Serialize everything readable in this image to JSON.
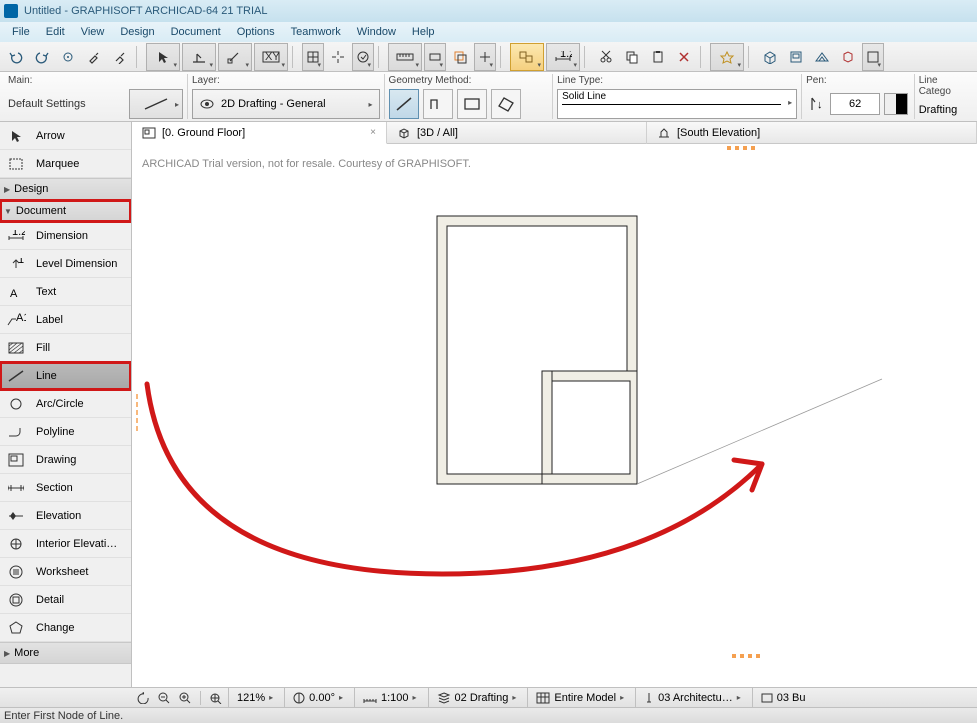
{
  "title": "Untitled - GRAPHISOFT ARCHICAD-64 21 TRIAL",
  "menubar": [
    "File",
    "Edit",
    "View",
    "Design",
    "Document",
    "Options",
    "Teamwork",
    "Window",
    "Help"
  ],
  "toolbar2": {
    "main_label": "Main:",
    "default_settings": "Default Settings",
    "layer_label": "Layer:",
    "layer_value": "2D Drafting - General",
    "geom_label": "Geometry Method:",
    "linetype_label": "Line Type:",
    "linetype_value": "Solid Line",
    "pen_label": "Pen:",
    "pen_value": "62",
    "linecat_label": "Line Catego",
    "linecat_value": "Drafting"
  },
  "toolbox": {
    "arrow": "Arrow",
    "marquee": "Marquee",
    "design": "Design",
    "document": "Document",
    "dimension": "Dimension",
    "level_dimension": "Level Dimension",
    "text": "Text",
    "label": "Label",
    "fill": "Fill",
    "line": "Line",
    "arc": "Arc/Circle",
    "polyline": "Polyline",
    "drawing": "Drawing",
    "section": "Section",
    "elevation_t": "Elevation",
    "interior": "Interior Elevati…",
    "worksheet": "Worksheet",
    "detail": "Detail",
    "change": "Change",
    "more": "More"
  },
  "tabs": {
    "t0": "[0. Ground Floor]",
    "t1": "[3D / All]",
    "t2": "[South Elevation]"
  },
  "watermark": "ARCHICAD Trial version, not for resale. Courtesy of GRAPHISOFT.",
  "bottom": {
    "zoom": "121%",
    "angle": "0.00°",
    "scale": "1:100",
    "layer_combo": "02 Drafting",
    "model": "Entire Model",
    "pen_set": "03 Architectu…",
    "extra": "03 Bu"
  },
  "status": "Enter First Node of Line."
}
